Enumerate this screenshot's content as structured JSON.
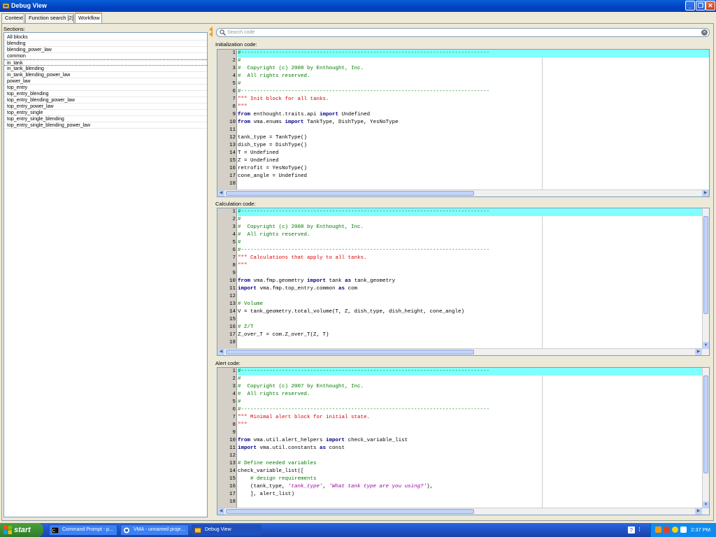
{
  "window": {
    "title": "Debug View"
  },
  "tabs": [
    {
      "label": "Context",
      "active": false
    },
    {
      "label": "Function search [2]",
      "active": false
    },
    {
      "label": "Workflow",
      "active": true
    }
  ],
  "sections": {
    "label": "Sections:",
    "items": [
      {
        "label": "All blocks"
      },
      {
        "label": "blending"
      },
      {
        "label": "blending_power_law"
      },
      {
        "label": "common"
      },
      {
        "label": "in_tank",
        "selected": true
      },
      {
        "label": "in_tank_blending"
      },
      {
        "label": "in_tank_blending_power_law"
      },
      {
        "label": "power_law"
      },
      {
        "label": "top_entry"
      },
      {
        "label": "top_entry_blending"
      },
      {
        "label": "top_entry_blending_power_law"
      },
      {
        "label": "top_entry_power_law"
      },
      {
        "label": "top_entry_single"
      },
      {
        "label": "top_entry_single_blending"
      },
      {
        "label": "top_entry_single_blending_power_law"
      }
    ]
  },
  "search": {
    "placeholder": "Search code"
  },
  "panels": [
    {
      "label": "Initialization code:",
      "lines": [
        [
          [
            "c",
            "#-------------------------------------------------------------------------------"
          ]
        ],
        [
          [
            "c",
            "#"
          ]
        ],
        [
          [
            "c",
            "#  Copyright (c) 2008 by Enthought, Inc."
          ]
        ],
        [
          [
            "c",
            "#  All rights reserved."
          ]
        ],
        [
          [
            "c",
            "#"
          ]
        ],
        [
          [
            "c",
            "#-------------------------------------------------------------------------------"
          ]
        ],
        [
          [
            "s",
            "\"\"\" Init block for all tanks."
          ]
        ],
        [
          [
            "s",
            "\"\"\""
          ]
        ],
        [
          [
            "k",
            "from"
          ],
          [
            "p",
            " enthought.traits.api "
          ],
          [
            "k",
            "import"
          ],
          [
            "p",
            " Undefined"
          ]
        ],
        [
          [
            "k",
            "from"
          ],
          [
            "p",
            " vma.enums "
          ],
          [
            "k",
            "import"
          ],
          [
            "p",
            " TankType, DishType, YesNoType"
          ]
        ],
        [],
        [
          [
            "p",
            "tank_type = TankType()"
          ]
        ],
        [
          [
            "p",
            "dish_type = DishType()"
          ]
        ],
        [
          [
            "p",
            "T = Undefined"
          ]
        ],
        [
          [
            "p",
            "Z = Undefined"
          ]
        ],
        [
          [
            "p",
            "retrofit = YesNoType()"
          ]
        ],
        [
          [
            "p",
            "cone_angle = Undefined"
          ]
        ],
        []
      ]
    },
    {
      "label": "Calculation code:",
      "lines": [
        [
          [
            "c",
            "#-------------------------------------------------------------------------------"
          ]
        ],
        [
          [
            "c",
            "#"
          ]
        ],
        [
          [
            "c",
            "#  Copyright (c) 2008 by Enthought, Inc."
          ]
        ],
        [
          [
            "c",
            "#  All rights reserved."
          ]
        ],
        [
          [
            "c",
            "#"
          ]
        ],
        [
          [
            "c",
            "#-------------------------------------------------------------------------------"
          ]
        ],
        [
          [
            "s",
            "\"\"\" Calculations that apply to all tanks."
          ]
        ],
        [
          [
            "s",
            "\"\"\""
          ]
        ],
        [],
        [
          [
            "k",
            "from"
          ],
          [
            "p",
            " vma.fmp.geometry "
          ],
          [
            "k",
            "import"
          ],
          [
            "p",
            " tank "
          ],
          [
            "k",
            "as"
          ],
          [
            "p",
            " tank_geometry"
          ]
        ],
        [
          [
            "k",
            "import"
          ],
          [
            "p",
            " vma.fmp.top_entry.common "
          ],
          [
            "k",
            "as"
          ],
          [
            "p",
            " com"
          ]
        ],
        [],
        [
          [
            "c",
            "# Volume"
          ]
        ],
        [
          [
            "p",
            "V = tank_geometry.total_volume(T, Z, dish_type, dish_height, cone_angle)"
          ]
        ],
        [],
        [
          [
            "c",
            "# Z/T"
          ]
        ],
        [
          [
            "p",
            "Z_over_T = com.Z_over_T(Z, T)"
          ]
        ],
        []
      ]
    },
    {
      "label": "Alert code:",
      "lines": [
        [
          [
            "c",
            "#-------------------------------------------------------------------------------"
          ]
        ],
        [
          [
            "c",
            "#"
          ]
        ],
        [
          [
            "c",
            "#  Copyright (c) 2007 by Enthought, Inc."
          ]
        ],
        [
          [
            "c",
            "#  All rights reserved."
          ]
        ],
        [
          [
            "c",
            "#"
          ]
        ],
        [
          [
            "c",
            "#-------------------------------------------------------------------------------"
          ]
        ],
        [
          [
            "s",
            "\"\"\" Minimal alert block for initial state."
          ]
        ],
        [
          [
            "s",
            "\"\"\""
          ]
        ],
        [],
        [
          [
            "k",
            "from"
          ],
          [
            "p",
            " vma.util.alert_helpers "
          ],
          [
            "k",
            "import"
          ],
          [
            "p",
            " check_variable_list"
          ]
        ],
        [
          [
            "k",
            "import"
          ],
          [
            "p",
            " vma.util.constants "
          ],
          [
            "k",
            "as"
          ],
          [
            "p",
            " const"
          ]
        ],
        [],
        [
          [
            "c",
            "# Define needed variables"
          ]
        ],
        [
          [
            "p",
            "check_variable_list(["
          ]
        ],
        [
          [
            "p",
            "    "
          ],
          [
            "c",
            "# design requirements"
          ]
        ],
        [
          [
            "p",
            "    (tank_type, "
          ],
          [
            "i",
            "'tank_type'"
          ],
          [
            "p",
            ", "
          ],
          [
            "i",
            "'What tank type are you using?'"
          ],
          [
            "p",
            "),"
          ]
        ],
        [
          [
            "p",
            "    ], alert_list)"
          ]
        ],
        []
      ]
    }
  ],
  "taskbar": {
    "start_label": "start",
    "buttons": [
      {
        "label": "Command Prompt - p..."
      },
      {
        "label": "VMA - unnamed proje..."
      },
      {
        "label": "Debug View",
        "active": true
      }
    ],
    "clock": "2:37 PM"
  },
  "colors": {
    "highlight_line": "#80ffff",
    "comment": "#007a00",
    "string": "#d40000",
    "keyword": "#000080",
    "italic_string": "#9b009b"
  }
}
